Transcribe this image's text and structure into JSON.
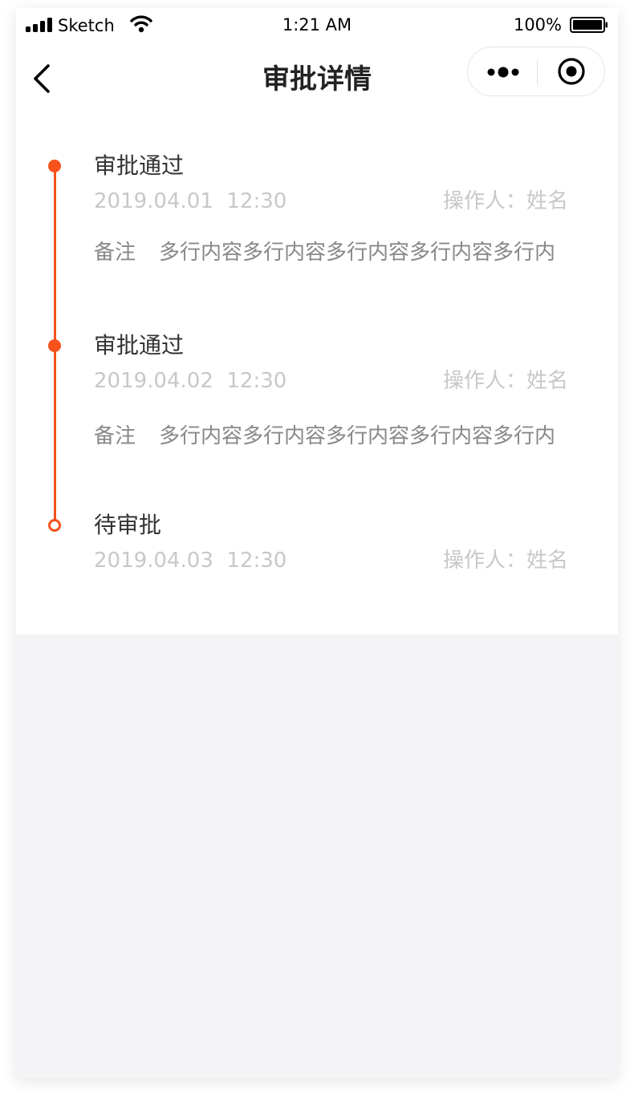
{
  "status_bar": {
    "carrier": "Sketch",
    "time": "1:21 AM",
    "battery": "100%"
  },
  "nav": {
    "title": "审批详情",
    "back_icon": "chevron-left-icon",
    "more_icon": "more-dots-icon",
    "close_icon": "target-circle-icon"
  },
  "timeline": {
    "accent_color": "#f7521c",
    "items": [
      {
        "status": "审批通过",
        "datetime": "2019.04.01  12:30",
        "operator": "操作人：姓名",
        "remark_label": "备注",
        "remark": "多行内容多行内容多行内容多行内容多行内"
      },
      {
        "status": "审批通过",
        "datetime": "2019.04.02  12:30",
        "operator": "操作人：姓名",
        "remark_label": "备注",
        "remark": "多行内容多行内容多行内容多行内容多行内"
      },
      {
        "status": "待审批",
        "datetime": "2019.04.03  12:30",
        "operator": "操作人：姓名"
      }
    ]
  }
}
